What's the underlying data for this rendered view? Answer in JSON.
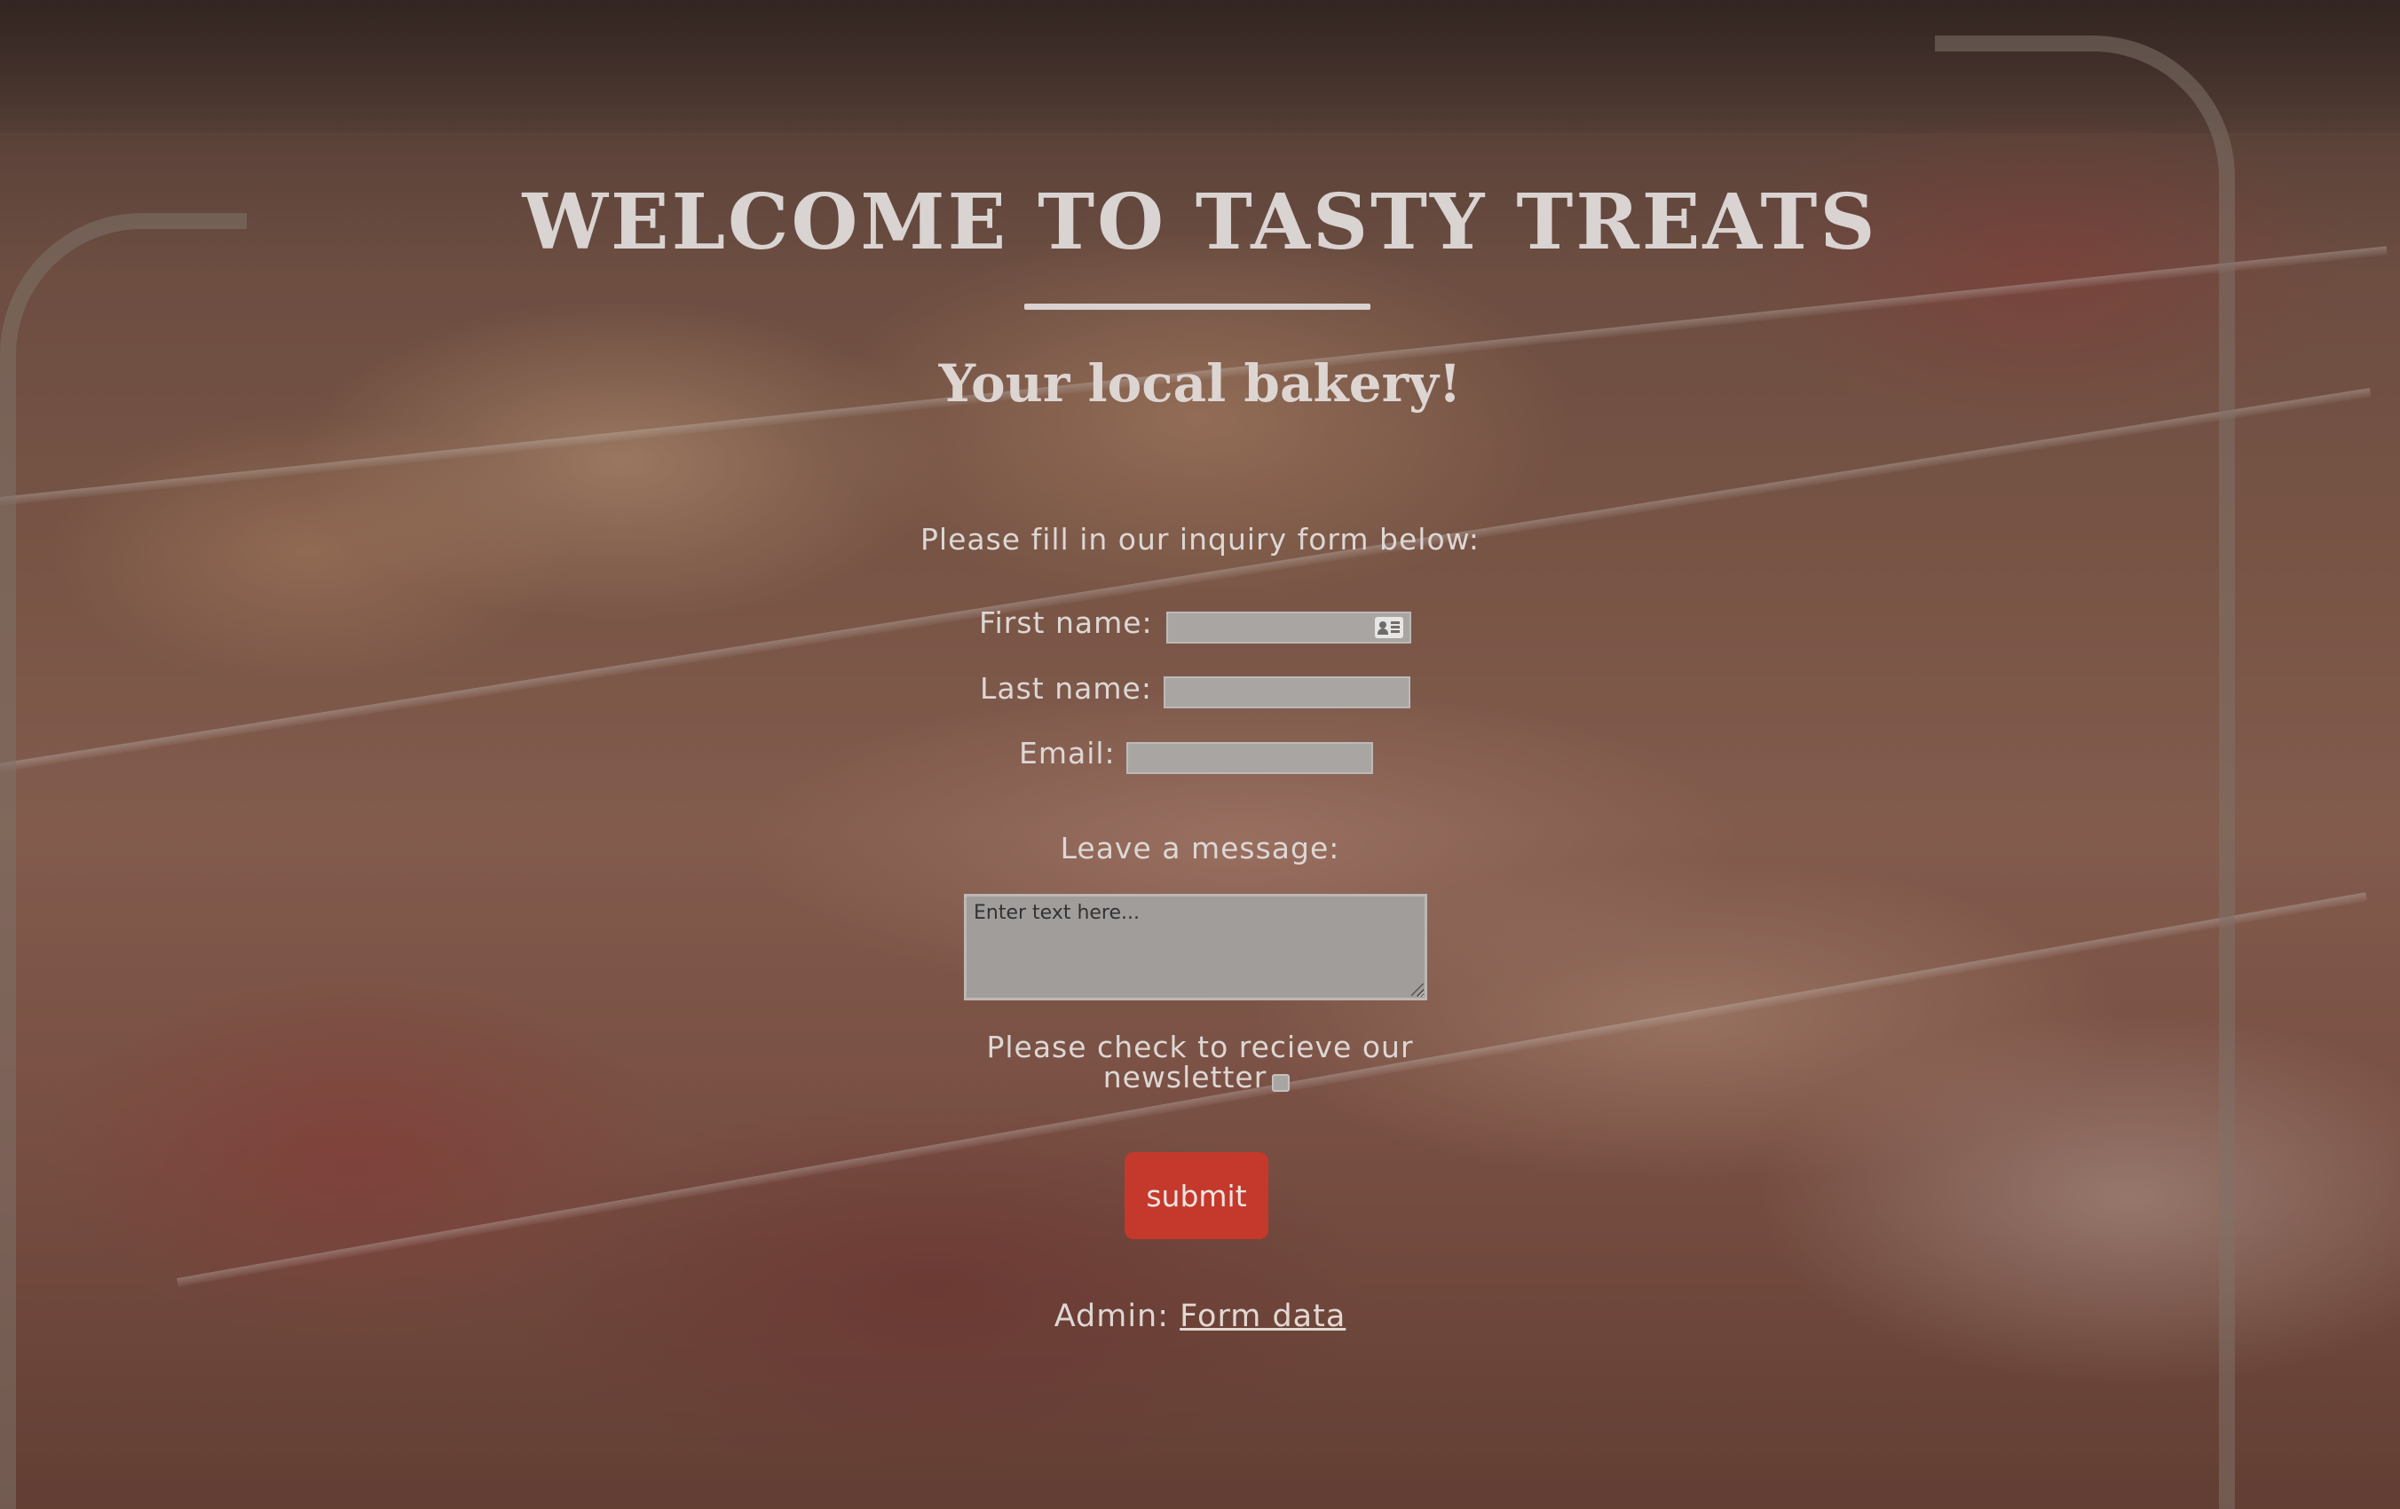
{
  "header": {
    "title": "WELCOME TO TASTY TREATS",
    "subtitle": "Your local bakery!"
  },
  "form": {
    "intro": "Please fill in our inquiry form below:",
    "first_name": {
      "label": "First name:",
      "value": "",
      "icon": "contact-card-icon"
    },
    "last_name": {
      "label": "Last name:",
      "value": ""
    },
    "email": {
      "label": "Email:",
      "value": ""
    },
    "message": {
      "label": "Leave a message:",
      "placeholder": "Enter text here..."
    },
    "newsletter": {
      "label_line1": "Please check to recieve our",
      "label_line2": "newsletter",
      "checked": false
    },
    "submit_label": "submit"
  },
  "admin": {
    "label": "Admin:",
    "link_text": "Form data"
  },
  "colors": {
    "submit": "#c4392c",
    "text": "#ddd7d4",
    "input_bg": "#a9a5a3"
  }
}
